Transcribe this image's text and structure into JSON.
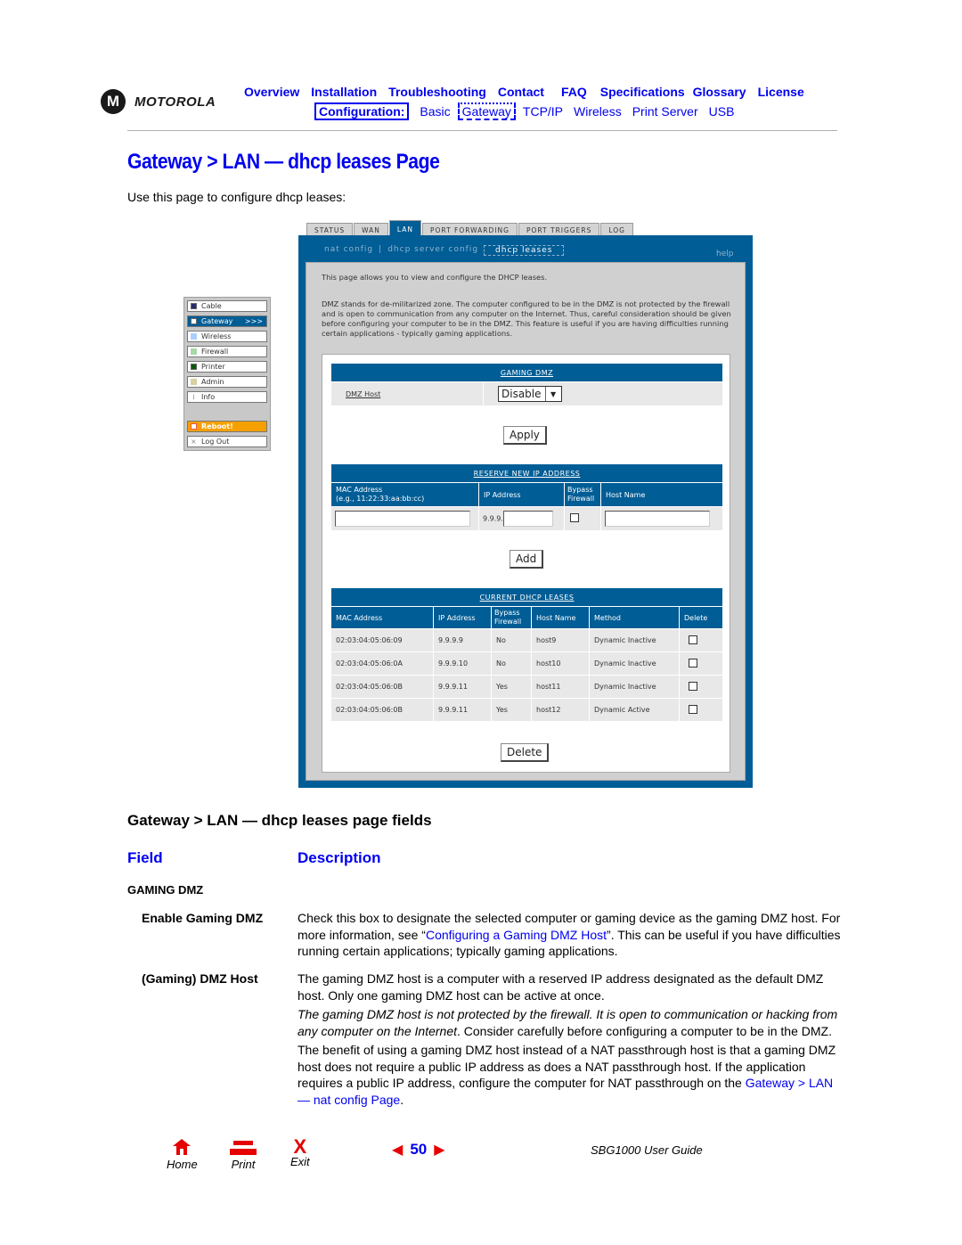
{
  "header": {
    "logo_text": "MOTOROLA",
    "logo_glyph": "M",
    "nav_top": [
      "Overview",
      "Installation",
      "Troubleshooting",
      "Contact",
      "FAQ",
      "Specifications",
      "Glossary",
      "License"
    ],
    "nav_config_label": "Configuration:",
    "nav_bottom": [
      "Basic",
      "Gateway",
      "TCP/IP",
      "Wireless",
      "Print Server",
      "USB"
    ],
    "nav_bottom_current": "Gateway"
  },
  "page": {
    "title": "Gateway > LAN — dhcp leases Page",
    "intro": "Use this page to configure dhcp leases:"
  },
  "router_ui": {
    "tabs": [
      "STATUS",
      "WAN",
      "LAN",
      "PORT FORWARDING",
      "PORT TRIGGERS",
      "LOG"
    ],
    "active_tab": "LAN",
    "subnav": [
      "nat config",
      "dhcp server config",
      "dhcp leases"
    ],
    "subnav_current": "dhcp leases",
    "help": "help",
    "sidebar": {
      "items": [
        {
          "label": "Cable",
          "color": "#2a2a6e"
        },
        {
          "label": "Gateway",
          "color": "#ffffff",
          "suffix": ">>>"
        },
        {
          "label": "Wireless",
          "color": "#a8d0ff"
        },
        {
          "label": "Firewall",
          "color": "#a8d8a8"
        },
        {
          "label": "Printer",
          "color": "#0a5a0a"
        },
        {
          "label": "Admin",
          "color": "#d8d0a0"
        },
        {
          "label": "Info",
          "glyph": "i"
        }
      ],
      "reboot": "Reboot!",
      "logout": "Log Out"
    },
    "description_1": "This page allows you to view and configure the DHCP leases.",
    "description_2": "DMZ stands for de-militarized zone. The computer configured to be in the DMZ is not protected by the firewall and is open to communication from any computer on the Internet. Thus, careful consideration should be given before configuring your computer to be in the DMZ. This feature is useful if you are having difficulties running certain applications - typically gaming applications.",
    "gaming_dmz": {
      "caption": "GAMING DMZ",
      "label": "DMZ Host",
      "select_value": "Disable",
      "apply": "Apply"
    },
    "reserve": {
      "caption": "RESERVE NEW IP ADDRESS",
      "col_mac": "MAC Address",
      "col_mac_hint": "(e.g., 11:22:33:aa:bb:cc)",
      "col_ip": "IP Address",
      "col_bypass_1": "Bypass",
      "col_bypass_2": "Firewall",
      "col_host": "Host Name",
      "ip_prefix": "9.9.9.",
      "mac_value": "",
      "ip_value": "",
      "host_value": "",
      "add": "Add"
    },
    "leases": {
      "caption": "CURRENT DHCP LEASES",
      "columns": [
        "MAC Address",
        "IP Address",
        "Bypass Firewall",
        "Host Name",
        "Method",
        "Delete"
      ],
      "rows": [
        {
          "mac": "02:03:04:05:06:09",
          "ip": "9.9.9.9",
          "bypass": "No",
          "host": "host9",
          "method": "Dynamic Inactive"
        },
        {
          "mac": "02:03:04:05:06:0A",
          "ip": "9.9.9.10",
          "bypass": "No",
          "host": "host10",
          "method": "Dynamic Inactive"
        },
        {
          "mac": "02:03:04:05:06:0B",
          "ip": "9.9.9.11",
          "bypass": "Yes",
          "host": "host11",
          "method": "Dynamic Inactive"
        },
        {
          "mac": "02:03:04:05:06:0B",
          "ip": "9.9.9.11",
          "bypass": "Yes",
          "host": "host12",
          "method": "Dynamic Active"
        }
      ],
      "delete": "Delete"
    }
  },
  "fields": {
    "title": "Gateway > LAN — dhcp leases page fields",
    "col_field": "Field",
    "col_description": "Description",
    "section": "GAMING DMZ",
    "enable_name": "Enable Gaming DMZ",
    "enable_desc_1": "Check this box to designate the selected computer or gaming device as the gaming DMZ host. For more information, see “",
    "enable_link": "Configuring a Gaming DMZ Host",
    "enable_desc_2": "”. This can be useful if you have difficulties running certain applications; typically gaming applications.",
    "host_name": "(Gaming) DMZ Host",
    "host_p1": "The gaming DMZ host is a computer with a reserved IP address designated as the default DMZ host. Only one gaming DMZ host can be active at once.",
    "host_p2_italic": "The gaming DMZ host is not protected by the firewall. It is open to communication or hacking from any computer on the Internet",
    "host_p2_rest": ". Consider carefully before configuring a computer to be in the DMZ.",
    "host_p3": "The benefit of using a gaming DMZ host instead of a NAT passthrough host is that a gaming DMZ host does not require a public IP address as does a NAT passthrough host. If the application requires a public IP address, configure the computer for NAT passthrough on the ",
    "host_p3_link": "Gateway > LAN — nat config Page",
    "host_p3_end": "."
  },
  "footer": {
    "home": "Home",
    "print": "Print",
    "exit": "Exit",
    "page_number": "50",
    "guide": "SBG1000 User Guide"
  },
  "colors": {
    "link_blue": "#0000ee",
    "router_blue": "#005d96",
    "footer_red": "#e60000",
    "reboot_orange": "#f5a000"
  }
}
